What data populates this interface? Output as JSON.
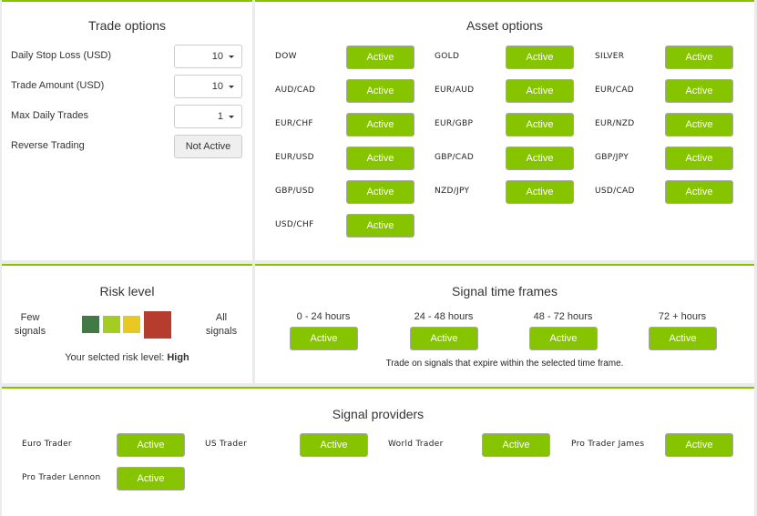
{
  "trade_options": {
    "title": "Trade options",
    "rows": [
      {
        "label": "Daily Stop Loss (USD)",
        "value": "10"
      },
      {
        "label": "Trade Amount (USD)",
        "value": "10"
      },
      {
        "label": "Max Daily Trades",
        "value": "1"
      }
    ],
    "reverse_trading": {
      "label": "Reverse Trading",
      "value": "Not Active"
    }
  },
  "asset_options": {
    "title": "Asset options",
    "assets": [
      {
        "name": "DOW",
        "status": "Active"
      },
      {
        "name": "GOLD",
        "status": "Active"
      },
      {
        "name": "SILVER",
        "status": "Active"
      },
      {
        "name": "AUD/CAD",
        "status": "Active"
      },
      {
        "name": "EUR/AUD",
        "status": "Active"
      },
      {
        "name": "EUR/CAD",
        "status": "Active"
      },
      {
        "name": "EUR/CHF",
        "status": "Active"
      },
      {
        "name": "EUR/GBP",
        "status": "Active"
      },
      {
        "name": "EUR/NZD",
        "status": "Active"
      },
      {
        "name": "EUR/USD",
        "status": "Active"
      },
      {
        "name": "GBP/CAD",
        "status": "Active"
      },
      {
        "name": "GBP/JPY",
        "status": "Active"
      },
      {
        "name": "GBP/USD",
        "status": "Active"
      },
      {
        "name": "NZD/JPY",
        "status": "Active"
      },
      {
        "name": "USD/CAD",
        "status": "Active"
      },
      {
        "name": "USD/CHF",
        "status": "Active"
      }
    ]
  },
  "risk_level": {
    "title": "Risk level",
    "left_label_line1": "Few",
    "left_label_line2": "signals",
    "right_label_line1": "All",
    "right_label_line2": "signals",
    "levels": [
      {
        "color": "#427944"
      },
      {
        "color": "#a5cc22"
      },
      {
        "color": "#e8c822"
      },
      {
        "color": "#b63c2e"
      }
    ],
    "selected_index": 3,
    "selected_prefix": "Your selcted risk level:",
    "selected_value": "High"
  },
  "signal_time_frames": {
    "title": "Signal time frames",
    "frames": [
      {
        "label": "0 - 24 hours",
        "status": "Active"
      },
      {
        "label": "24 - 48 hours",
        "status": "Active"
      },
      {
        "label": "48 - 72 hours",
        "status": "Active"
      },
      {
        "label": "72 + hours",
        "status": "Active"
      }
    ],
    "note": "Trade on signals that expire within the selected time frame."
  },
  "signal_providers": {
    "title": "Signal providers",
    "providers": [
      {
        "name": "Euro Trader",
        "status": "Active"
      },
      {
        "name": "US Trader",
        "status": "Active"
      },
      {
        "name": "World Trader",
        "status": "Active"
      },
      {
        "name": "Pro Trader James",
        "status": "Active"
      },
      {
        "name": "Pro Trader Lennon",
        "status": "Active"
      }
    ]
  },
  "colors": {
    "accent": "#86c400",
    "background": "#ebebeb"
  }
}
